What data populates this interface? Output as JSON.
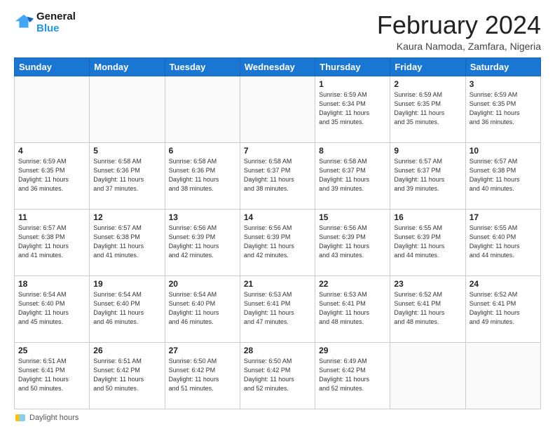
{
  "header": {
    "logo_line1": "General",
    "logo_line2": "Blue",
    "title": "February 2024",
    "subtitle": "Kaura Namoda, Zamfara, Nigeria"
  },
  "footer": {
    "label": "Daylight hours"
  },
  "weekdays": [
    "Sunday",
    "Monday",
    "Tuesday",
    "Wednesday",
    "Thursday",
    "Friday",
    "Saturday"
  ],
  "weeks": [
    [
      {
        "day": "",
        "info": ""
      },
      {
        "day": "",
        "info": ""
      },
      {
        "day": "",
        "info": ""
      },
      {
        "day": "",
        "info": ""
      },
      {
        "day": "1",
        "info": "Sunrise: 6:59 AM\nSunset: 6:34 PM\nDaylight: 11 hours\nand 35 minutes."
      },
      {
        "day": "2",
        "info": "Sunrise: 6:59 AM\nSunset: 6:35 PM\nDaylight: 11 hours\nand 35 minutes."
      },
      {
        "day": "3",
        "info": "Sunrise: 6:59 AM\nSunset: 6:35 PM\nDaylight: 11 hours\nand 36 minutes."
      }
    ],
    [
      {
        "day": "4",
        "info": "Sunrise: 6:59 AM\nSunset: 6:35 PM\nDaylight: 11 hours\nand 36 minutes."
      },
      {
        "day": "5",
        "info": "Sunrise: 6:58 AM\nSunset: 6:36 PM\nDaylight: 11 hours\nand 37 minutes."
      },
      {
        "day": "6",
        "info": "Sunrise: 6:58 AM\nSunset: 6:36 PM\nDaylight: 11 hours\nand 38 minutes."
      },
      {
        "day": "7",
        "info": "Sunrise: 6:58 AM\nSunset: 6:37 PM\nDaylight: 11 hours\nand 38 minutes."
      },
      {
        "day": "8",
        "info": "Sunrise: 6:58 AM\nSunset: 6:37 PM\nDaylight: 11 hours\nand 39 minutes."
      },
      {
        "day": "9",
        "info": "Sunrise: 6:57 AM\nSunset: 6:37 PM\nDaylight: 11 hours\nand 39 minutes."
      },
      {
        "day": "10",
        "info": "Sunrise: 6:57 AM\nSunset: 6:38 PM\nDaylight: 11 hours\nand 40 minutes."
      }
    ],
    [
      {
        "day": "11",
        "info": "Sunrise: 6:57 AM\nSunset: 6:38 PM\nDaylight: 11 hours\nand 41 minutes."
      },
      {
        "day": "12",
        "info": "Sunrise: 6:57 AM\nSunset: 6:38 PM\nDaylight: 11 hours\nand 41 minutes."
      },
      {
        "day": "13",
        "info": "Sunrise: 6:56 AM\nSunset: 6:39 PM\nDaylight: 11 hours\nand 42 minutes."
      },
      {
        "day": "14",
        "info": "Sunrise: 6:56 AM\nSunset: 6:39 PM\nDaylight: 11 hours\nand 42 minutes."
      },
      {
        "day": "15",
        "info": "Sunrise: 6:56 AM\nSunset: 6:39 PM\nDaylight: 11 hours\nand 43 minutes."
      },
      {
        "day": "16",
        "info": "Sunrise: 6:55 AM\nSunset: 6:39 PM\nDaylight: 11 hours\nand 44 minutes."
      },
      {
        "day": "17",
        "info": "Sunrise: 6:55 AM\nSunset: 6:40 PM\nDaylight: 11 hours\nand 44 minutes."
      }
    ],
    [
      {
        "day": "18",
        "info": "Sunrise: 6:54 AM\nSunset: 6:40 PM\nDaylight: 11 hours\nand 45 minutes."
      },
      {
        "day": "19",
        "info": "Sunrise: 6:54 AM\nSunset: 6:40 PM\nDaylight: 11 hours\nand 46 minutes."
      },
      {
        "day": "20",
        "info": "Sunrise: 6:54 AM\nSunset: 6:40 PM\nDaylight: 11 hours\nand 46 minutes."
      },
      {
        "day": "21",
        "info": "Sunrise: 6:53 AM\nSunset: 6:41 PM\nDaylight: 11 hours\nand 47 minutes."
      },
      {
        "day": "22",
        "info": "Sunrise: 6:53 AM\nSunset: 6:41 PM\nDaylight: 11 hours\nand 48 minutes."
      },
      {
        "day": "23",
        "info": "Sunrise: 6:52 AM\nSunset: 6:41 PM\nDaylight: 11 hours\nand 48 minutes."
      },
      {
        "day": "24",
        "info": "Sunrise: 6:52 AM\nSunset: 6:41 PM\nDaylight: 11 hours\nand 49 minutes."
      }
    ],
    [
      {
        "day": "25",
        "info": "Sunrise: 6:51 AM\nSunset: 6:41 PM\nDaylight: 11 hours\nand 50 minutes."
      },
      {
        "day": "26",
        "info": "Sunrise: 6:51 AM\nSunset: 6:42 PM\nDaylight: 11 hours\nand 50 minutes."
      },
      {
        "day": "27",
        "info": "Sunrise: 6:50 AM\nSunset: 6:42 PM\nDaylight: 11 hours\nand 51 minutes."
      },
      {
        "day": "28",
        "info": "Sunrise: 6:50 AM\nSunset: 6:42 PM\nDaylight: 11 hours\nand 52 minutes."
      },
      {
        "day": "29",
        "info": "Sunrise: 6:49 AM\nSunset: 6:42 PM\nDaylight: 11 hours\nand 52 minutes."
      },
      {
        "day": "",
        "info": ""
      },
      {
        "day": "",
        "info": ""
      }
    ]
  ]
}
